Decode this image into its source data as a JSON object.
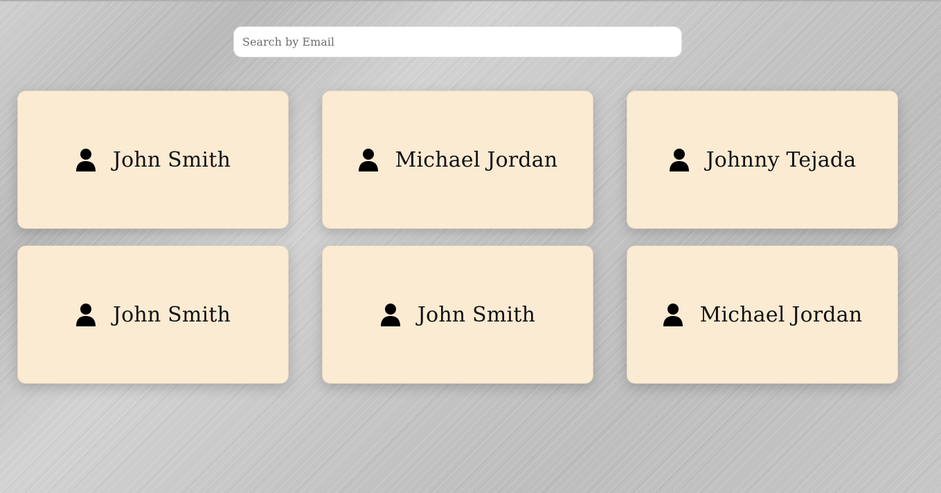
{
  "search": {
    "placeholder": "Search by Email",
    "value": ""
  },
  "cards": [
    {
      "name": "John Smith",
      "icon": "person-icon"
    },
    {
      "name": "Michael Jordan",
      "icon": "person-icon"
    },
    {
      "name": "Johnny Tejada",
      "icon": "person-icon"
    },
    {
      "name": "John Smith",
      "icon": "person-icon"
    },
    {
      "name": "John Smith",
      "icon": "person-icon"
    },
    {
      "name": "Michael Jordan",
      "icon": "person-icon"
    }
  ],
  "colors": {
    "card_background": "#fcebd3",
    "page_background": "#c2c2c2",
    "text": "#111111"
  }
}
